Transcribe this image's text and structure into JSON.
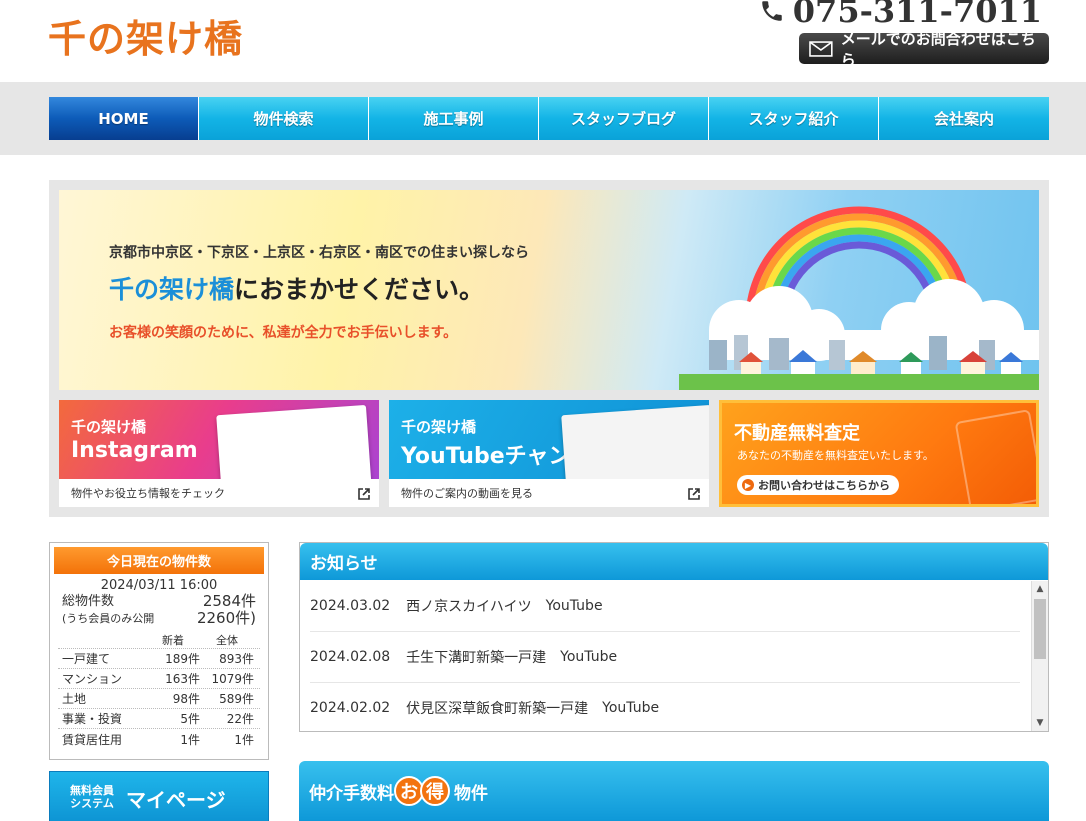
{
  "header": {
    "logo": "千の架け橋",
    "phone": "075-311-7011",
    "mail_button": "メールでのお問合わせはこちら"
  },
  "nav": {
    "items": [
      "HOME",
      "物件検索",
      "施工事例",
      "スタッフブログ",
      "スタッフ紹介",
      "会社案内"
    ]
  },
  "hero": {
    "line1": "京都市中京区・下京区・上京区・右京区・南区での住まい探しなら",
    "line2_brand": "千の架け橋",
    "line2_rest": "におまかせください。",
    "line3": "お客様の笑顔のために、私達が全力でお手伝いします。"
  },
  "banners": {
    "instagram": {
      "small": "千の架け橋",
      "big": "Instagram",
      "caption": "物件やお役立ち情報をチェック"
    },
    "youtube": {
      "small": "千の架け橋",
      "big": "YouTubeチャンネル",
      "caption": "物件のご案内の動画を見る"
    },
    "estimate": {
      "title": "不動産無料査定",
      "sub": "あなたの不動産を無料査定いたします。",
      "button": "お問い合わせはこちらから"
    }
  },
  "stock": {
    "title": "今日現在の物件数",
    "date": "2024/03/11 16:00",
    "total_label": "総物件数",
    "total_value": "2584件",
    "member_label": "(うち会員のみ公開",
    "member_value": "2260件)",
    "col_new": "新着",
    "col_all": "全体",
    "rows": [
      {
        "type": "一戸建て",
        "new": "189件",
        "all": "893件"
      },
      {
        "type": "マンション",
        "new": "163件",
        "all": "1079件"
      },
      {
        "type": "土地",
        "new": "98件",
        "all": "589件"
      },
      {
        "type": "事業・投資",
        "new": "5件",
        "all": "22件"
      },
      {
        "type": "賃貸居住用",
        "new": "1件",
        "all": "1件"
      }
    ]
  },
  "mypage": {
    "small1": "無料会員",
    "small2": "システム",
    "big": "マイページ"
  },
  "news": {
    "title": "お知らせ",
    "items": [
      {
        "date": "2024.03.02",
        "title": "西ノ京スカイハイツ",
        "tag": "YouTube"
      },
      {
        "date": "2024.02.08",
        "title": "壬生下溝町新築一戸建",
        "tag": "YouTube"
      },
      {
        "date": "2024.02.02",
        "title": "伏見区深草飯食町新築一戸建",
        "tag": "YouTube"
      }
    ]
  },
  "commission": {
    "before": "仲介手数料",
    "char1": "お",
    "char2": "得",
    "after": "物件"
  },
  "colors": {
    "accent_orange": "#e8731e",
    "nav_blue": "#13b4e6",
    "nav_active": "#0d5bb8"
  }
}
